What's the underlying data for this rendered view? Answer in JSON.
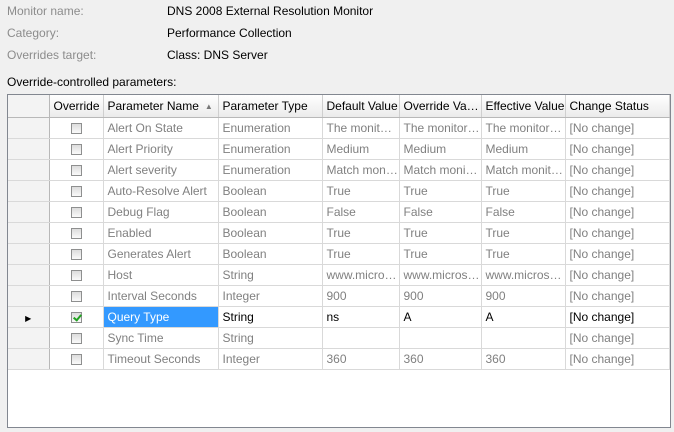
{
  "info": {
    "monitor_name_label": "Monitor name:",
    "monitor_name_value": "DNS 2008 External Resolution Monitor",
    "category_label": "Category:",
    "category_value": "Performance Collection",
    "overrides_target_label": "Overrides target:",
    "overrides_target_value": "Class: DNS Server"
  },
  "section_label": "Override-controlled parameters:",
  "grid": {
    "columns": [
      "Override",
      "Parameter Name",
      "Parameter Type",
      "Default Value",
      "Override Value",
      "Effective Value",
      "Change Status"
    ],
    "rows": [
      {
        "override": false,
        "name": "Alert On State",
        "type": "Enumeration",
        "default": "The monitor ...",
        "override_value": "The monitor is...",
        "effective": "The monitor is...",
        "status": "[No change]"
      },
      {
        "override": false,
        "name": "Alert Priority",
        "type": "Enumeration",
        "default": "Medium",
        "override_value": "Medium",
        "effective": "Medium",
        "status": "[No change]"
      },
      {
        "override": false,
        "name": "Alert severity",
        "type": "Enumeration",
        "default": "Match monito...",
        "override_value": "Match monito...",
        "effective": "Match monito...",
        "status": "[No change]"
      },
      {
        "override": false,
        "name": "Auto-Resolve Alert",
        "type": "Boolean",
        "default": "True",
        "override_value": "True",
        "effective": "True",
        "status": "[No change]"
      },
      {
        "override": false,
        "name": "Debug Flag",
        "type": "Boolean",
        "default": "False",
        "override_value": "False",
        "effective": "False",
        "status": "[No change]"
      },
      {
        "override": false,
        "name": "Enabled",
        "type": "Boolean",
        "default": "True",
        "override_value": "True",
        "effective": "True",
        "status": "[No change]"
      },
      {
        "override": false,
        "name": "Generates Alert",
        "type": "Boolean",
        "default": "True",
        "override_value": "True",
        "effective": "True",
        "status": "[No change]"
      },
      {
        "override": false,
        "name": "Host",
        "type": "String",
        "default": "www.micros...",
        "override_value": "www.microsof...",
        "effective": "www.microsof...",
        "status": "[No change]"
      },
      {
        "override": false,
        "name": "Interval Seconds",
        "type": "Integer",
        "default": "900",
        "override_value": "900",
        "effective": "900",
        "status": "[No change]"
      },
      {
        "override": true,
        "name": "Query Type",
        "type": "String",
        "default": "ns",
        "override_value": "A",
        "effective": "A",
        "status": "[No change]"
      },
      {
        "override": false,
        "name": "Sync Time",
        "type": "String",
        "default": "",
        "override_value": "",
        "effective": "",
        "status": "[No change]"
      },
      {
        "override": false,
        "name": "Timeout Seconds",
        "type": "Integer",
        "default": "360",
        "override_value": "360",
        "effective": "360",
        "status": "[No change]"
      }
    ]
  },
  "icons": {
    "sort": "sort-ascending-icon",
    "current_row": "current-row-arrow-icon"
  },
  "colors": {
    "selection": "#3399ff",
    "disabled_text": "#808080",
    "label_gray": "#8c8c8c"
  }
}
